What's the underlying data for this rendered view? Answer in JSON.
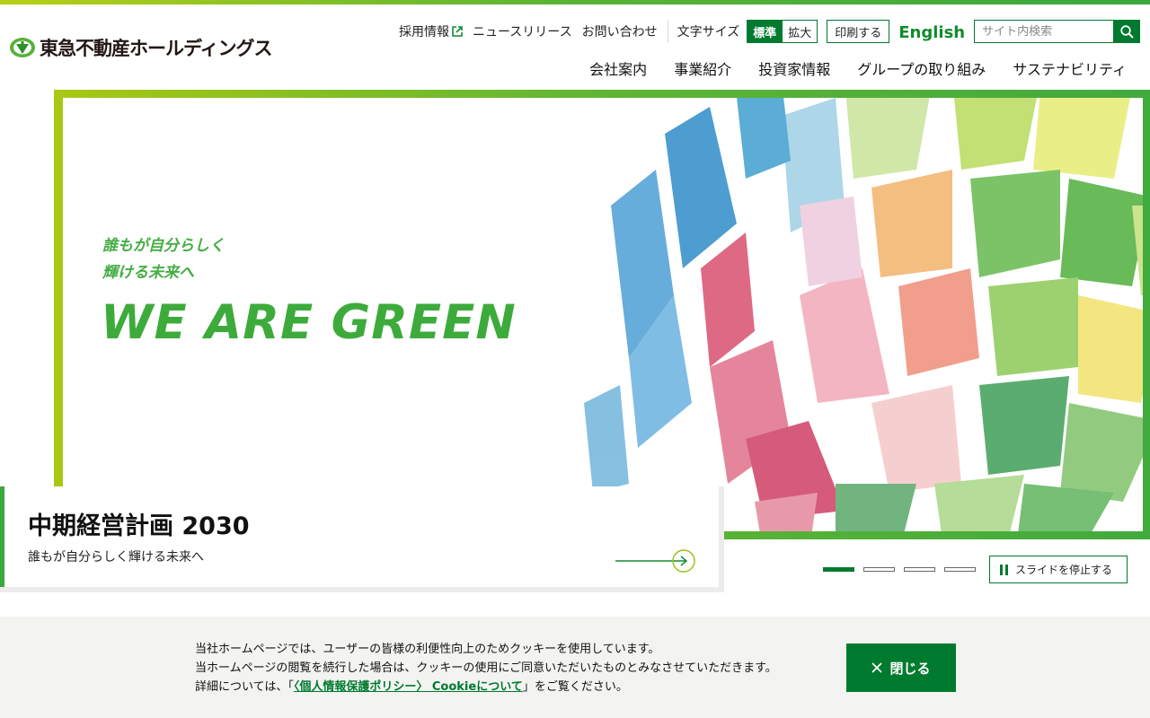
{
  "header": {
    "logo_text": "東急不動産ホールディングス",
    "utility": {
      "recruit": "採用情報",
      "news": "ニュースリリース",
      "contact": "お問い合わせ",
      "font_size_label": "文字サイズ",
      "font_standard": "標準",
      "font_large": "拡大",
      "print": "印刷する",
      "english": "English"
    },
    "search": {
      "placeholder": "サイト内検索",
      "value": ""
    },
    "nav": [
      "会社案内",
      "事業紹介",
      "投資家情報",
      "グループの取り組み",
      "サステナビリティ"
    ]
  },
  "hero": {
    "tagline_line1": "誰もが自分らしく",
    "tagline_line2": "輝ける未来へ",
    "headline": "WE ARE GREEN",
    "caption_title": "中期経営計画 2030",
    "caption_subtitle": "誰もが自分らしく輝ける未来へ"
  },
  "slider": {
    "slide_count": 4,
    "active_index": 0,
    "pause_label": "スライドを停止する"
  },
  "cookie": {
    "line1": "当社ホームページでは、ユーザーの皆様の利便性向上のためクッキーを使用しています。",
    "line2": "当ホームページの閲覧を続行した場合は、クッキーの使用にご同意いただいたものとみなさせていただきます。",
    "line3_prefix": "詳細については、「",
    "line3_link": "〈個人情報保護ポリシー〉 Cookieについて",
    "line3_suffix": "」をご覧ください。",
    "close_label": "閉じる"
  },
  "colors": {
    "brand_green": "#007a2e",
    "accent_green": "#3aa83c",
    "lime": "#b7cf15"
  }
}
